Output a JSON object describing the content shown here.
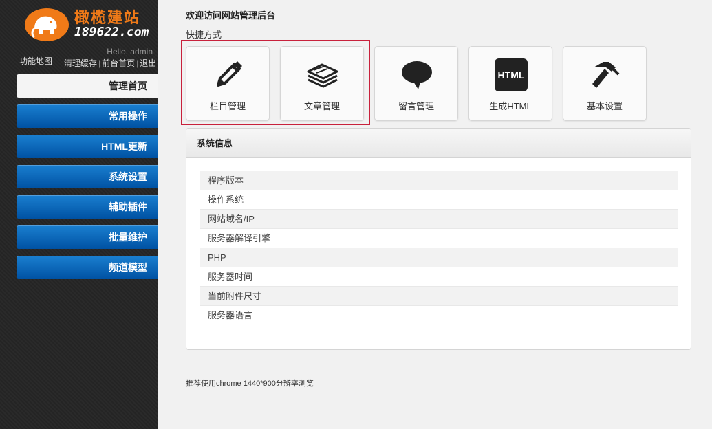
{
  "sidebar": {
    "logo": {
      "line1": "橄榄建站",
      "line2": "189622.com"
    },
    "hello": "Hello, admin",
    "sitemap": "功能地图",
    "links": [
      "清理缓存",
      "前台首页",
      "退出"
    ],
    "nav": [
      {
        "label": "管理首页",
        "active": true
      },
      {
        "label": "常用操作"
      },
      {
        "label": "HTML更新"
      },
      {
        "label": "系统设置"
      },
      {
        "label": "辅助插件"
      },
      {
        "label": "批量维护"
      },
      {
        "label": "频道模型"
      }
    ]
  },
  "main": {
    "welcome": "欢迎访问网站管理后台",
    "shortcut_title": "快捷方式",
    "tiles": [
      {
        "label": "栏目管理",
        "icon": "pencil-icon"
      },
      {
        "label": "文章管理",
        "icon": "papers-stack-icon"
      },
      {
        "label": "留言管理",
        "icon": "speech-bubble-icon"
      },
      {
        "label": "生成HTML",
        "icon": "html-icon",
        "icon_text": "HTML"
      },
      {
        "label": "基本设置",
        "icon": "hammer-icon"
      }
    ],
    "system": {
      "title": "系统信息",
      "rows": [
        "程序版本",
        "操作系统",
        "网站域名/IP",
        "服务器解译引擎",
        "PHP",
        "服务器时间",
        "当前附件尺寸",
        "服务器语言"
      ]
    },
    "footer": "推荐使用chrome 1440*900分辨率浏览"
  },
  "colors": {
    "nav_blue": "#0a68bf",
    "logo_orange": "#f07a18",
    "highlight": "#c8213c"
  }
}
